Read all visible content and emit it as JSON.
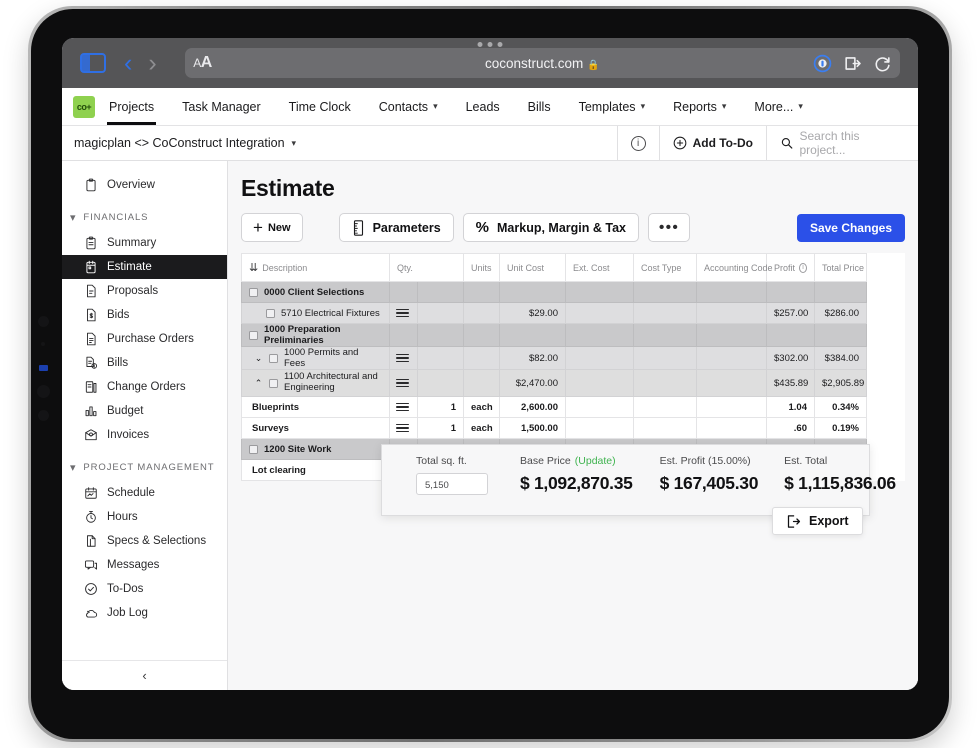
{
  "browser": {
    "url": "coconstruct.com",
    "lock_icon": "lock-icon",
    "aa_label": "AA",
    "back_icon": "chevron-left-icon",
    "forward_icon": "chevron-right-icon",
    "sidebar_icon": "sidebar-toggle-icon",
    "reader_icon": "reader-icon",
    "extension_icon": "extension-icon",
    "reload_icon": "reload-icon"
  },
  "app_nav": {
    "logo_text": "co+",
    "items": [
      {
        "label": "Projects",
        "has_caret": false,
        "active": true
      },
      {
        "label": "Task Manager",
        "has_caret": false,
        "active": false
      },
      {
        "label": "Time Clock",
        "has_caret": false,
        "active": false
      },
      {
        "label": "Contacts",
        "has_caret": true,
        "active": false
      },
      {
        "label": "Leads",
        "has_caret": false,
        "active": false
      },
      {
        "label": "Bills",
        "has_caret": false,
        "active": false
      },
      {
        "label": "Templates",
        "has_caret": true,
        "active": false
      },
      {
        "label": "Reports",
        "has_caret": true,
        "active": false
      },
      {
        "label": "More...",
        "has_caret": true,
        "active": false
      }
    ]
  },
  "project_bar": {
    "project_name": "magicplan <> CoConstruct Integration",
    "info_icon": "info-icon",
    "add_todo_label": "Add To-Do",
    "add_todo_icon": "plus-circle-icon",
    "search_icon": "search-icon",
    "search_placeholder": "Search this project..."
  },
  "sidebar": {
    "top": [
      {
        "label": "Overview",
        "icon": "clipboard-icon",
        "active": false
      }
    ],
    "groups": [
      {
        "title": "FINANCIALS",
        "items": [
          {
            "label": "Summary",
            "icon": "clipboard-list-icon",
            "active": false
          },
          {
            "label": "Estimate",
            "icon": "calendar-doc-icon",
            "active": true
          },
          {
            "label": "Proposals",
            "icon": "document-icon",
            "active": false
          },
          {
            "label": "Bids",
            "icon": "dollar-doc-icon",
            "active": false
          },
          {
            "label": "Purchase Orders",
            "icon": "order-doc-icon",
            "active": false
          },
          {
            "label": "Bills",
            "icon": "bill-doc-icon",
            "active": false
          },
          {
            "label": "Change Orders",
            "icon": "change-order-icon",
            "active": false
          },
          {
            "label": "Budget",
            "icon": "bar-chart-icon",
            "active": false
          },
          {
            "label": "Invoices",
            "icon": "invoice-icon",
            "active": false
          }
        ]
      },
      {
        "title": "PROJECT MANAGEMENT",
        "items": [
          {
            "label": "Schedule",
            "icon": "calendar-icon",
            "active": false
          },
          {
            "label": "Hours",
            "icon": "stopwatch-icon",
            "active": false
          },
          {
            "label": "Specs & Selections",
            "icon": "page-flip-icon",
            "active": false
          },
          {
            "label": "Messages",
            "icon": "chat-icon",
            "active": false
          },
          {
            "label": "To-Dos",
            "icon": "check-circle-icon",
            "active": false
          },
          {
            "label": "Job Log",
            "icon": "cloud-icon",
            "active": false
          }
        ]
      }
    ],
    "collapse_icon": "chevron-left-icon"
  },
  "main": {
    "page_title": "Estimate",
    "toolbar": {
      "new_label": "New",
      "new_icon": "plus-icon",
      "parameters_label": "Parameters",
      "parameters_icon": "ruler-icon",
      "markup_label": "Markup, Margin & Tax",
      "markup_icon": "percent-icon",
      "more_label": "•••",
      "save_label": "Save Changes"
    },
    "table": {
      "sort_icon": "double-chevron-down-icon",
      "columns": [
        "Description",
        "Qty.",
        "Units",
        "Unit Cost",
        "Ext. Cost",
        "Cost Type",
        "Accounting Code",
        "Profit",
        "Total Price"
      ],
      "profit_info_icon": "info-icon",
      "rows": [
        {
          "level": "lvl0",
          "checkbox": true,
          "expander": "",
          "description": "0000 Client Selections",
          "hamburger": false,
          "qty": "",
          "units": "",
          "unit_cost": "",
          "ext_cost": "",
          "cost_type": "",
          "accounting_code": "",
          "profit": "",
          "total_price": ""
        },
        {
          "level": "lvl1",
          "checkbox": true,
          "expander": "",
          "indent": "ind2",
          "description": "5710 Electrical Fixtures",
          "hamburger": true,
          "qty": "",
          "units": "",
          "unit_cost": "$29.00",
          "ext_cost": "",
          "cost_type": "",
          "accounting_code": "",
          "profit": "$257.00",
          "total_price": "$286.00"
        },
        {
          "level": "lvl0",
          "checkbox": true,
          "expander": "",
          "description": "1000 Preparation Preliminaries",
          "hamburger": false,
          "qty": "",
          "units": "",
          "unit_cost": "",
          "ext_cost": "",
          "cost_type": "",
          "accounting_code": "",
          "profit": "",
          "total_price": ""
        },
        {
          "level": "lvl1",
          "checkbox": true,
          "expander": "v",
          "indent": "ind1",
          "description": "1000 Permits and Fees",
          "hamburger": true,
          "qty": "",
          "units": "",
          "unit_cost": "$82.00",
          "ext_cost": "",
          "cost_type": "",
          "accounting_code": "",
          "profit": "$302.00",
          "total_price": "$384.00"
        },
        {
          "level": "lvl1b",
          "checkbox": true,
          "expander": "^",
          "indent": "ind1",
          "description": "1100 Architectural and Engineering",
          "hamburger": true,
          "qty": "",
          "units": "",
          "unit_cost": "$2,470.00",
          "ext_cost": "",
          "cost_type": "",
          "accounting_code": "",
          "profit": "$435.89",
          "total_price": "$2,905.89",
          "tall": true
        },
        {
          "level": "leaf",
          "checkbox": false,
          "expander": "",
          "indent": "ind3",
          "description": "Blueprints",
          "hamburger": true,
          "qty": "1",
          "units": "each",
          "unit_cost": "2,600.00",
          "ext_cost": "",
          "cost_type": "",
          "accounting_code": "",
          "profit": "1.04",
          "total_price": "0.34%"
        },
        {
          "level": "leaf",
          "checkbox": false,
          "expander": "",
          "indent": "ind3",
          "description": "Surveys",
          "hamburger": true,
          "qty": "1",
          "units": "each",
          "unit_cost": "1,500.00",
          "ext_cost": "",
          "cost_type": "",
          "accounting_code": "",
          "profit": ".60",
          "total_price": "0.19%"
        },
        {
          "level": "lvl0",
          "checkbox": true,
          "expander": "",
          "description": "1200 Site Work",
          "hamburger": true,
          "qty": "",
          "units": "",
          "unit_cost": "",
          "ext_cost": "",
          "cost_type": "",
          "accounting_code": "",
          "profit": "",
          "total_price": ""
        },
        {
          "level": "leaf",
          "checkbox": false,
          "expander": "",
          "indent": "ind3",
          "description": "Lot clearing",
          "hamburger": false,
          "qty": "",
          "units": "",
          "unit_cost": "",
          "ext_cost": "",
          "cost_type": "",
          "accounting_code": "",
          "profit": "",
          "total_price": ""
        }
      ]
    },
    "summary": {
      "sqft_label": "Total sq. ft.",
      "sqft_value": "5,150",
      "base_price_label": "Base Price",
      "base_price_update": "(Update)",
      "base_price_value": "$ 1,092,870.35",
      "profit_label": "Est. Profit (15.00%)",
      "profit_value": "$ 167,405.30",
      "total_label": "Est. Total",
      "total_value": "$ 1,115,836.06",
      "export_label": "Export",
      "export_icon": "export-icon"
    }
  },
  "colors": {
    "accent_blue": "#2b50e8",
    "logo_green": "#8fd14f",
    "update_green": "#3fb34f",
    "active_sidebar": "#1b1b1d"
  }
}
